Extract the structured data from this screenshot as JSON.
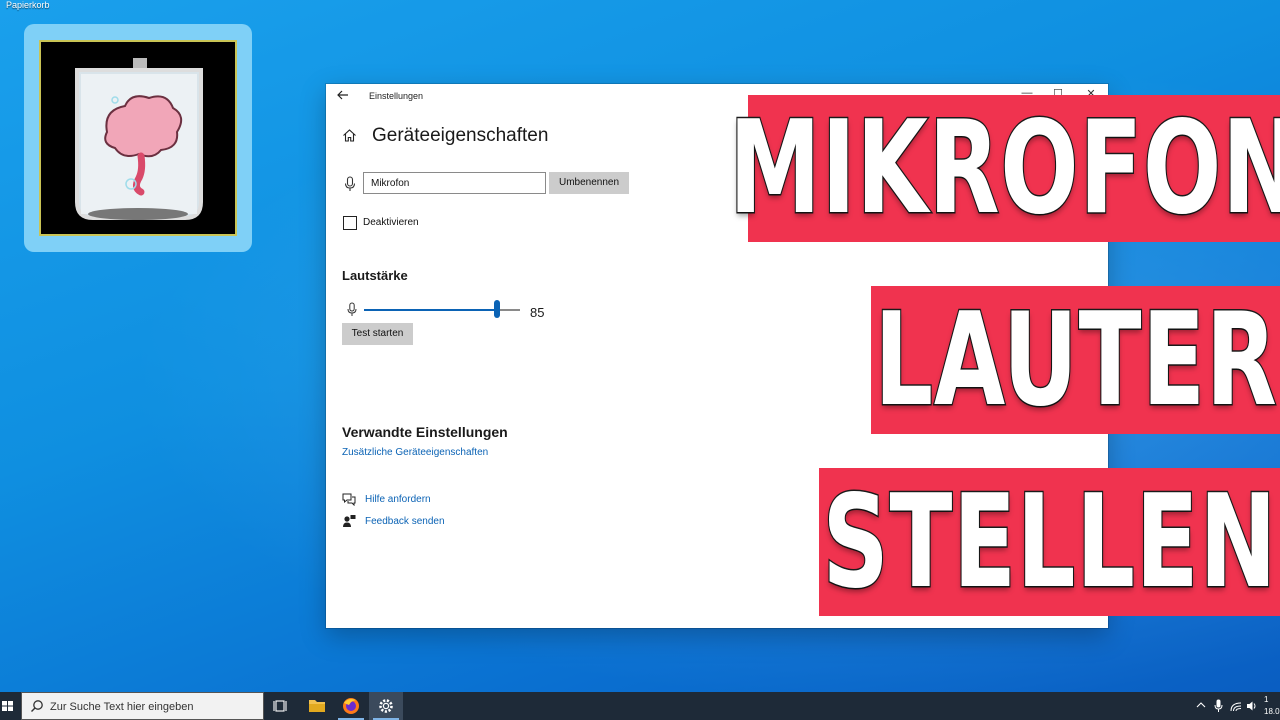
{
  "desktop": {
    "recycle_bin_label": "Papierkorb"
  },
  "window": {
    "title": "Einstellungen",
    "controls": {
      "minimize": "—",
      "maximize": "☐",
      "close": "✕"
    },
    "page_title": "Geräteeigenschaften",
    "device_name_value": "Mikrofon",
    "rename_button": "Umbenennen",
    "disable_checkbox_label": "Deaktivieren",
    "disable_checked": false,
    "volume_heading": "Lautstärke",
    "volume_value": "85",
    "volume_level": 85,
    "test_button": "Test starten",
    "related_heading": "Verwandte Einstellungen",
    "related_link": "Zusätzliche Geräteeigenschaften",
    "help_link": "Hilfe anfordern",
    "feedback_link": "Feedback senden"
  },
  "banners": {
    "line1": "MIKROFON",
    "line2": "LAUTER",
    "line3": "STELLEN",
    "color": "#f0334f"
  },
  "taskbar": {
    "search_placeholder": "Zur Suche Text hier eingeben",
    "clock_time": "1",
    "clock_date": "18.0"
  },
  "colors": {
    "accent": "#0b63b5",
    "taskbar": "#1e2a38",
    "desktop": "#1aa0ec"
  }
}
